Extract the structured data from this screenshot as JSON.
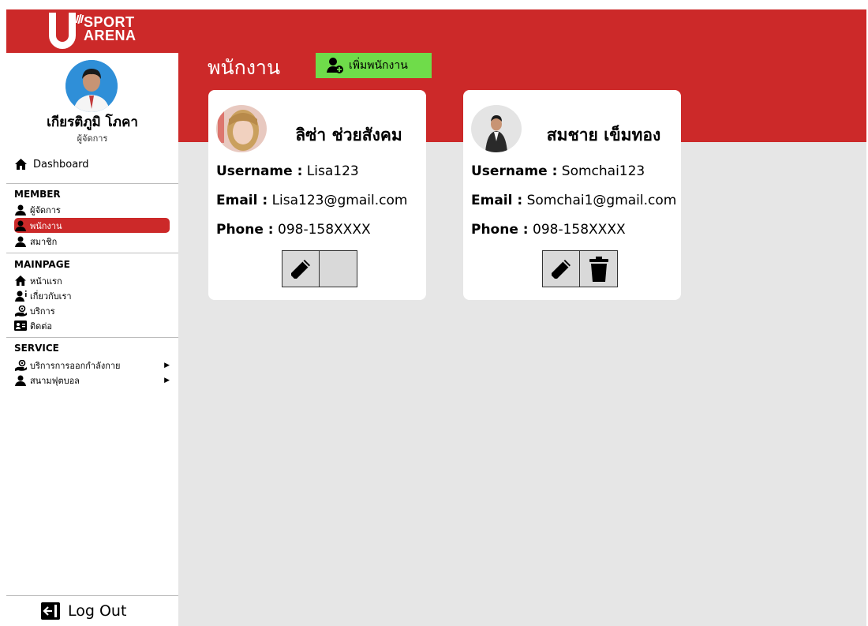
{
  "brand": {
    "line1": "SPORT",
    "line2": "ARENA"
  },
  "sidebar": {
    "user_name": "เกียรติภูมิ โภคา",
    "user_role": "ผู้จัดการ",
    "dashboard_label": "Dashboard",
    "sections": [
      {
        "title": "MEMBER"
      },
      {
        "title": "MAINPAGE"
      },
      {
        "title": "SERVICE"
      }
    ],
    "member_items": [
      {
        "label": "ผู้จัดการ",
        "icon": "user-icon"
      },
      {
        "label": "พนักงาน",
        "icon": "user-icon",
        "active": true
      },
      {
        "label": "สมาชิก",
        "icon": "user-icon"
      }
    ],
    "mainpage_items": [
      {
        "label": "หน้าแรก",
        "icon": "home-icon"
      },
      {
        "label": "เกี่ยวกับเรา",
        "icon": "user-info-icon"
      },
      {
        "label": "บริการ",
        "icon": "service-hand-icon"
      },
      {
        "label": "ติดต่อ",
        "icon": "contact-card-icon"
      }
    ],
    "service_items": [
      {
        "label": "บริการการออกกำลังกาย",
        "icon": "service-hand-icon"
      },
      {
        "label": "สนามฟุตบอล",
        "icon": "user-icon"
      }
    ],
    "logout_label": "Log Out"
  },
  "header": {
    "title": "พนักงาน",
    "add_button_label": "เพิ่มพนักงาน"
  },
  "labels": {
    "username": "Username :",
    "email": "Email :",
    "phone": "Phone :"
  },
  "employees": [
    {
      "name": "ลิซ่า ช่วยสังคม",
      "username": "Lisa123",
      "email": "Lisa123@gmail.com",
      "phone": "098-158XXXX"
    },
    {
      "name": "สมชาย เข็มทอง",
      "username": "Somchai123",
      "email": "Somchai1@gmail.com",
      "phone": "098-158XXXX"
    }
  ],
  "colors": {
    "brand_red": "#cc2929",
    "add_green": "#6fdc4a",
    "content_bg": "#e6e6e6"
  }
}
